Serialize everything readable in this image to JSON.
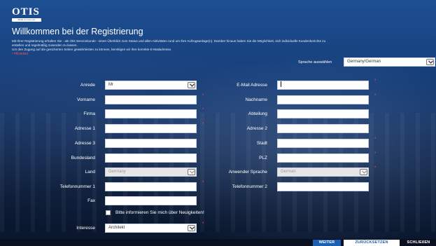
{
  "header": {
    "logo_text": "OTIS",
    "logo_subtext": "Made to move you",
    "title": "Willkommen bei der Registrierung",
    "intro_line1": "Mit Ihrer Registrierung erhalten Sie - als Otis Servicekunde - einen Überblick zum Status und allen Aktivitäten rund um Ihre Aufzugsanlage(n). Darüber hinaus haben Sie die Möglichkeit, sich individuelle Kundenberichte zu",
    "intro_line2": "erstellen und regelmäßig zusenden zu lassen.",
    "intro_line3": "Um den Zugang auf die gesicherten Seiten gewährleisten zu können, benötigen wir Ihre korrekte E-Mailadresse.",
    "required_note": "* Pflichtfeld"
  },
  "language": {
    "label": "Sprache auswählen",
    "selected": "Germany/German"
  },
  "form": {
    "anrede": {
      "label": "Anrede",
      "value": "Mr"
    },
    "vorname": {
      "label": "Vorname"
    },
    "firma": {
      "label": "Firma"
    },
    "adresse1": {
      "label": "Adresse 1"
    },
    "adresse3": {
      "label": "Adresse 3"
    },
    "bundesland": {
      "label": "Bundesland"
    },
    "land": {
      "label": "Land",
      "value": "Germany"
    },
    "telefon1": {
      "label": "Telefonnummer 1"
    },
    "fax": {
      "label": "Fax"
    },
    "newsletter": {
      "label": "Bitte informieren Sie mich über Neuigkeiten!"
    },
    "interesse": {
      "label": "Interesse",
      "value": "Architekt"
    },
    "email": {
      "label": "E-Mail Adresse"
    },
    "nachname": {
      "label": "Nachname"
    },
    "abteilung": {
      "label": "Abteilung"
    },
    "adresse2": {
      "label": "Adresse 2"
    },
    "stadt": {
      "label": "Stadt"
    },
    "plz": {
      "label": "PLZ"
    },
    "anwender_sprache": {
      "label": "Anwender Sprache",
      "value": "German"
    },
    "telefon2": {
      "label": "Telefonnummer 2"
    },
    "required_mark": "*"
  },
  "buttons": {
    "weiter": "WEITER",
    "reset": "ZURÜCKSETZEN",
    "close": "SCHLIEßEN"
  },
  "colors": {
    "background_top": "#1d4f93",
    "background_bottom": "#0a162c",
    "primary_button": "#1c5fb0",
    "required": "#ff4b4b"
  }
}
